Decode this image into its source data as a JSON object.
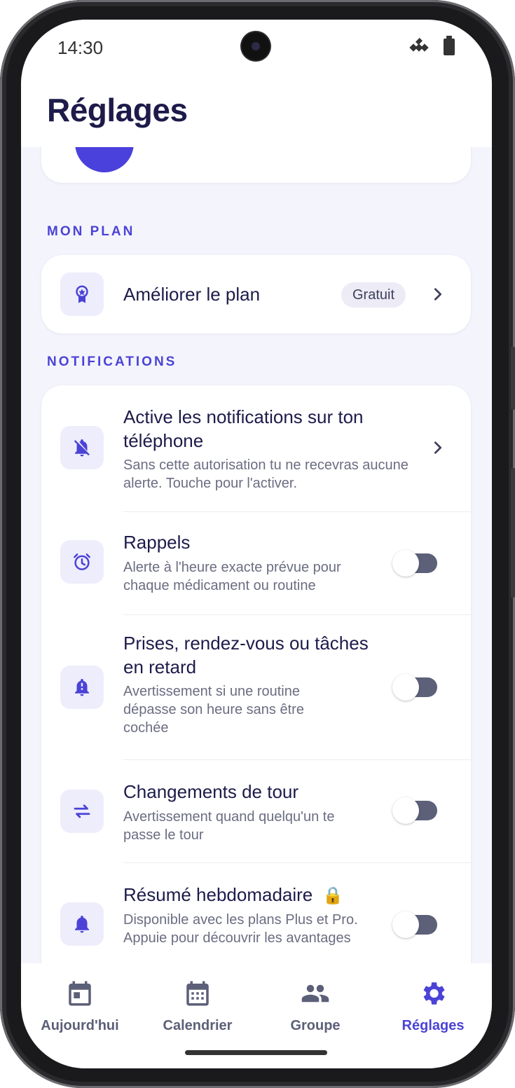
{
  "status_bar": {
    "time": "14:30"
  },
  "header": {
    "title": "Réglages"
  },
  "sections": {
    "plan": {
      "label": "MON PLAN",
      "upgrade": {
        "title": "Améliorer le plan",
        "badge": "Gratuit"
      }
    },
    "notifications": {
      "label": "NOTIFICATIONS",
      "items": [
        {
          "title": "Active les notifications sur ton téléphone",
          "subtitle": "Sans cette autorisation tu ne recevras aucune alerte. Touche pour l'activer.",
          "icon": "bell-off-icon"
        },
        {
          "title": "Rappels",
          "subtitle": "Alerte à l'heure exacte prévue pour chaque médicament ou routine",
          "icon": "alarm-clock-icon",
          "enabled": false
        },
        {
          "title": "Prises, rendez-vous ou tâches en retard",
          "subtitle": "Avertissement si une routine dépasse son heure sans être cochée",
          "icon": "bell-alert-icon",
          "enabled": false
        },
        {
          "title": "Changements de tour",
          "subtitle": "Avertissement quand quelqu'un te passe le tour",
          "icon": "swap-arrows-icon",
          "enabled": false
        },
        {
          "title": "Résumé hebdomadaire",
          "subtitle": "Disponible avec les plans Plus et Pro. Appuie pour découvrir les avantages",
          "icon": "bell-icon",
          "locked": true,
          "enabled": false
        }
      ]
    }
  },
  "bottom_nav": {
    "items": [
      {
        "label": "Aujourd'hui",
        "icon": "calendar-today-icon"
      },
      {
        "label": "Calendrier",
        "icon": "calendar-month-icon"
      },
      {
        "label": "Groupe",
        "icon": "group-icon"
      },
      {
        "label": "Réglages",
        "icon": "gear-icon",
        "active": true
      }
    ]
  },
  "colors": {
    "accent": "#4b43d6",
    "title": "#1d1b4a",
    "background": "#f4f5fc"
  }
}
